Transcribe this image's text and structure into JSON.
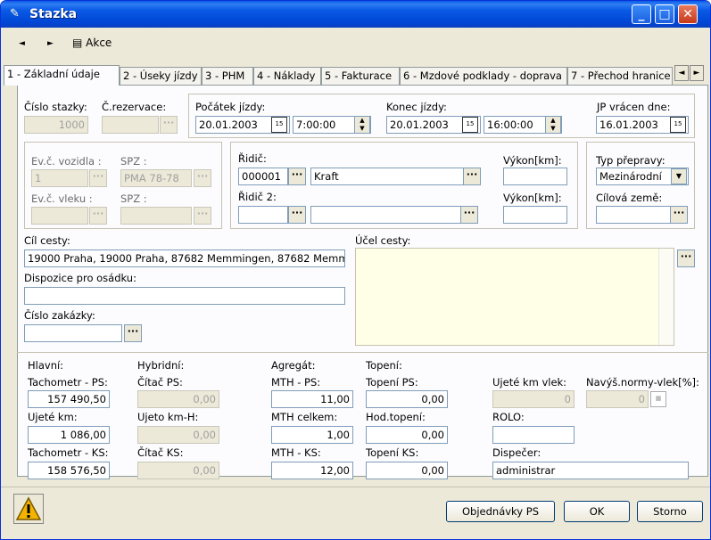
{
  "window": {
    "title": "Stazka"
  },
  "toolbar": {
    "back": "◄",
    "forward": "►",
    "akce": "Akce"
  },
  "tabs": [
    "1 - Základní údaje",
    "2 - Úseky jízdy",
    "3 - PHM",
    "4 - Náklady",
    "5 - Fakturace",
    "6 - Mzdové podklady - doprava",
    "7 - Přechod hranice"
  ],
  "top": {
    "cislo_stazky_label": "Číslo stazky:",
    "cislo_stazky": "1000",
    "c_rezervace_label": "Č.rezervace:",
    "c_rezervace": "",
    "pocatek_label": "Počátek jízdy:",
    "pocatek_date": "20.01.2003",
    "pocatek_time": "7:00:00",
    "konec_label": "Konec jízdy:",
    "konec_date": "20.01.2003",
    "konec_time": "16:00:00",
    "jp_label": "JP vrácen dne:",
    "jp_date": "16.01.2003"
  },
  "vehicle": {
    "evc_vozidla_label": "Ev.č. vozidla :",
    "evc_vozidla": "1",
    "spz1_label": "SPZ :",
    "spz1": "PMA 78-78",
    "evc_vleku_label": "Ev.č. vleku :",
    "evc_vleku": "",
    "spz2_label": "SPZ :",
    "spz2": ""
  },
  "driver": {
    "ridic_label": "Řidič:",
    "ridic_code": "000001",
    "ridic_name": "Kraft",
    "ridic2_label": "Řidič 2:",
    "ridic2_code": "",
    "ridic2_name": "",
    "vykon1_label": "Výkon[km]:",
    "vykon1": "",
    "vykon2_label": "Výkon[km]:",
    "vykon2": ""
  },
  "transport": {
    "typ_label": "Typ přepravy:",
    "typ": "Mezinárodní",
    "cilova_label": "Cílová země:",
    "cilova": ""
  },
  "route": {
    "cil_label": "Cíl cesty:",
    "cil": "19000 Praha, 19000 Praha, 87682 Memmingen, 87682 Memm",
    "dispozice_label": "Dispozice pro osádku:",
    "dispozice": "",
    "zakazka_label": "Číslo zakázky:",
    "zakazka": "",
    "ucel_label": "Účel cesty:",
    "ucel": ""
  },
  "stats": {
    "hlavni": "Hlavní:",
    "hybridni": "Hybridní:",
    "agregat": "Agregát:",
    "topeni": "Topení:",
    "tach_ps_label": "Tachometr - PS:",
    "tach_ps": "157 490,50",
    "ujete_label": "Ujeté km:",
    "ujete": "1 086,00",
    "tach_ks_label": "Tachometr - KS:",
    "tach_ks": "158 576,50",
    "citac_ps_label": "Čítač PS:",
    "citac_ps": "0,00",
    "ujeto_h_label": "Ujeto km-H:",
    "ujeto_h": "0,00",
    "citac_ks_label": "Čítač KS:",
    "citac_ks": "0,00",
    "mth_ps_label": "MTH - PS:",
    "mth_ps": "11,00",
    "mth_celkem_label": "MTH celkem:",
    "mth_celkem": "1,00",
    "mth_ks_label": "MTH - KS:",
    "mth_ks": "12,00",
    "top_ps_label": "Topení PS:",
    "top_ps": "0,00",
    "hod_top_label": "Hod.topení:",
    "hod_top": "0,00",
    "top_ks_label": "Topení KS:",
    "top_ks": "0,00",
    "ujete_vlek_label": "Ujeté km vlek:",
    "ujete_vlek": "0",
    "navys_label": "Navýš.normy-vlek[%]:",
    "navys": "0",
    "rolo_label": "ROLO:",
    "rolo": "",
    "dispecer_label": "Dispečer:",
    "dispecer": "administrar"
  },
  "footer": {
    "objednavky": "Objednávky PS",
    "ok": "OK",
    "storno": "Storno"
  }
}
